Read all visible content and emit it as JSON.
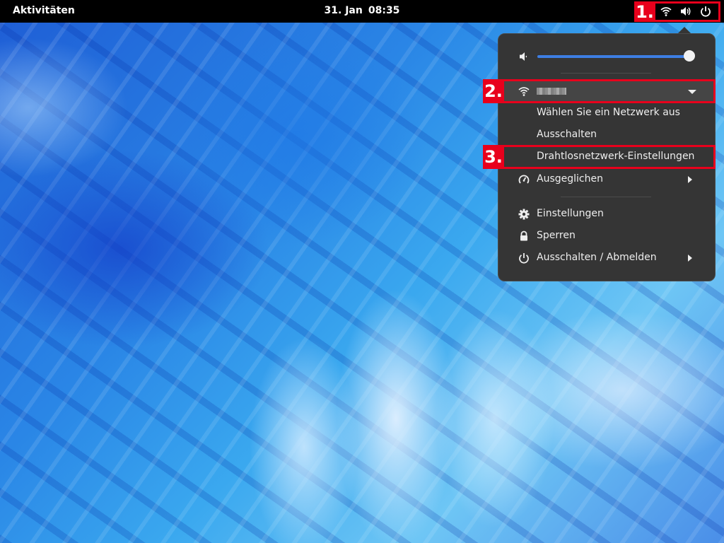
{
  "topbar": {
    "activities": "Aktivitäten",
    "date": "31. Jan",
    "time": "08:35",
    "tray_icons": [
      "wifi-icon",
      "volume-icon",
      "power-icon"
    ]
  },
  "menu": {
    "volume": {
      "icon": "speaker-muted-icon",
      "level": 1.0
    },
    "wifi": {
      "icon": "wifi-icon",
      "ssid": "",
      "items": [
        {
          "label": "Wählen Sie ein Netzwerk aus"
        },
        {
          "label": "Ausschalten"
        },
        {
          "label": "Drahtlosnetzwerk-Einstellungen"
        }
      ]
    },
    "power_mode": {
      "icon": "power-profile-icon",
      "label": "Ausgeglichen"
    },
    "actions": [
      {
        "icon": "gear-icon",
        "label": "Einstellungen"
      },
      {
        "icon": "lock-icon",
        "label": "Sperren"
      },
      {
        "icon": "power-icon",
        "label": "Ausschalten / Abmelden"
      }
    ]
  },
  "annotations": [
    {
      "number": "1."
    },
    {
      "number": "2."
    },
    {
      "number": "3."
    }
  ],
  "colors": {
    "highlight": "#e8001c",
    "accent": "#3d7ee3",
    "menu_bg": "#353535"
  }
}
